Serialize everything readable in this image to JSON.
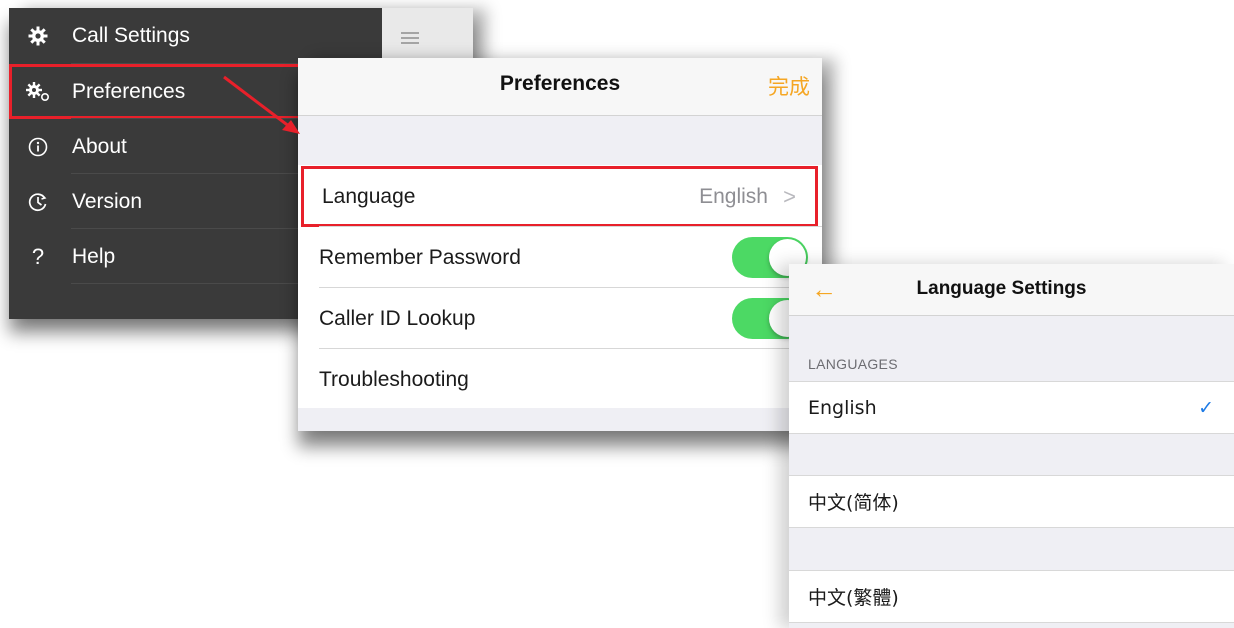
{
  "menu": {
    "items": [
      {
        "label": "Call Settings",
        "icon": "gear-icon"
      },
      {
        "label": "Preferences",
        "icon": "gears-icon"
      },
      {
        "label": "About",
        "icon": "info-icon"
      },
      {
        "label": "Version",
        "icon": "version-clock-icon"
      },
      {
        "label": "Help",
        "icon": "question-icon"
      }
    ],
    "hamburger_icon": "hamburger-menu-icon"
  },
  "preferences": {
    "title": "Preferences",
    "done_label": "完成",
    "rows": {
      "language": {
        "label": "Language",
        "value": "English",
        "chevron": ">"
      },
      "remember_password": {
        "label": "Remember Password",
        "enabled": true
      },
      "caller_id": {
        "label": "Caller ID Lookup",
        "enabled": true
      },
      "troubleshooting": {
        "label": "Troubleshooting"
      }
    }
  },
  "language_settings": {
    "back_glyph": "←",
    "title": "Language Settings",
    "section_label": "LANGUAGES",
    "languages": [
      {
        "name": "English",
        "selected": true,
        "check": "✓"
      },
      {
        "name": "中文(简体)",
        "selected": false
      },
      {
        "name": "中文(繁體)",
        "selected": false
      }
    ]
  },
  "colors": {
    "menu_bg": "#3a3a3a",
    "accent_orange": "#f5a623",
    "toggle_green": "#4cd964",
    "highlight_red": "#e8202a",
    "check_blue": "#1e7be6"
  }
}
